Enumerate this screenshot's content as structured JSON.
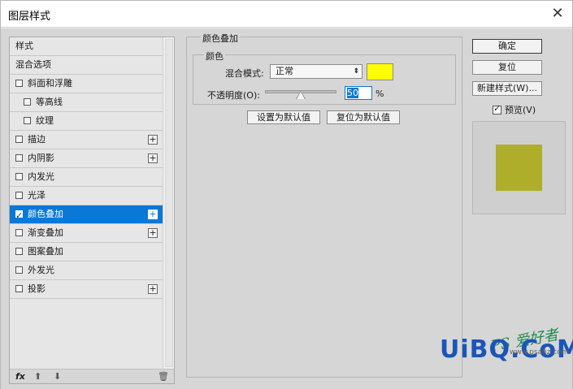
{
  "window": {
    "title": "图层样式",
    "close": "✕"
  },
  "styles_list": {
    "items": [
      {
        "label": "样式",
        "checkbox": false,
        "checked": false,
        "plus": false,
        "indent": false,
        "selected": false
      },
      {
        "label": "混合选项",
        "checkbox": false,
        "checked": false,
        "plus": false,
        "indent": false,
        "selected": false
      },
      {
        "label": "斜面和浮雕",
        "checkbox": true,
        "checked": false,
        "plus": false,
        "indent": false,
        "selected": false
      },
      {
        "label": "等高线",
        "checkbox": true,
        "checked": false,
        "plus": false,
        "indent": true,
        "selected": false
      },
      {
        "label": "纹理",
        "checkbox": true,
        "checked": false,
        "plus": false,
        "indent": true,
        "selected": false
      },
      {
        "label": "描边",
        "checkbox": true,
        "checked": false,
        "plus": true,
        "indent": false,
        "selected": false
      },
      {
        "label": "内阴影",
        "checkbox": true,
        "checked": false,
        "plus": true,
        "indent": false,
        "selected": false
      },
      {
        "label": "内发光",
        "checkbox": true,
        "checked": false,
        "plus": false,
        "indent": false,
        "selected": false
      },
      {
        "label": "光泽",
        "checkbox": true,
        "checked": false,
        "plus": false,
        "indent": false,
        "selected": false
      },
      {
        "label": "颜色叠加",
        "checkbox": true,
        "checked": true,
        "plus": true,
        "indent": false,
        "selected": true
      },
      {
        "label": "渐变叠加",
        "checkbox": true,
        "checked": false,
        "plus": true,
        "indent": false,
        "selected": false
      },
      {
        "label": "图案叠加",
        "checkbox": true,
        "checked": false,
        "plus": false,
        "indent": false,
        "selected": false
      },
      {
        "label": "外发光",
        "checkbox": true,
        "checked": false,
        "plus": false,
        "indent": false,
        "selected": false
      },
      {
        "label": "投影",
        "checkbox": true,
        "checked": false,
        "plus": true,
        "indent": false,
        "selected": false
      }
    ],
    "toolbar": {
      "fx": "fx",
      "up": "⬆",
      "down": "⬇",
      "trash": "🗑"
    }
  },
  "color_overlay": {
    "section_title": "颜色叠加",
    "group_title": "颜色",
    "blend_mode_label": "混合模式:",
    "blend_mode_value": "正常",
    "blend_arrow": "⬍",
    "overlay_color": "#ffff00",
    "opacity_label": "不透明度(O):",
    "opacity_value": "50",
    "opacity_unit": "%",
    "opacity_fraction": 0.5,
    "set_default_button": "设置为默认值",
    "reset_default_button": "复位为默认值"
  },
  "right_panel": {
    "ok_button": "确定",
    "reset_button": "复位",
    "new_style_button": "新建样式(W)...",
    "preview_label": "预览(V)",
    "preview_checked": true,
    "preview_color": "#aeae2a"
  },
  "watermark": {
    "top": "PS 爱好者",
    "bottom": "UiBQ.CoM",
    "url": "www.psahz.com"
  }
}
